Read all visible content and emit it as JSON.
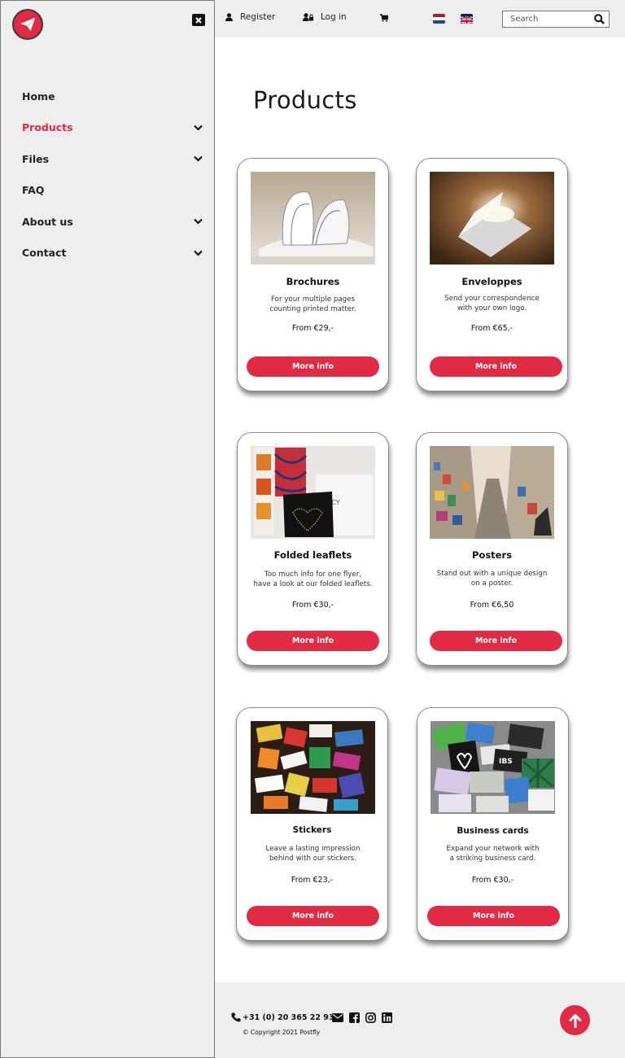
{
  "sidebar": {
    "logo_icon": "paper-plane-icon",
    "close_icon": "close-icon",
    "items": [
      {
        "label": "Home",
        "has_dropdown": false,
        "active": false
      },
      {
        "label": "Products",
        "has_dropdown": true,
        "active": true
      },
      {
        "label": "Files",
        "has_dropdown": true,
        "active": false
      },
      {
        "label": "FAQ",
        "has_dropdown": false,
        "active": false
      },
      {
        "label": "About us",
        "has_dropdown": true,
        "active": false
      },
      {
        "label": "Contact",
        "has_dropdown": true,
        "active": false
      }
    ]
  },
  "topbar": {
    "register_label": "Register",
    "login_label": "Log in",
    "cart_icon": "cart-icon",
    "languages": [
      "nl-flag-icon",
      "uk-flag-icon"
    ],
    "search_placeholder": "Search"
  },
  "main": {
    "title": "Products",
    "button_label": "More info",
    "products": [
      {
        "name": "Brochures",
        "desc": [
          "For your multiple pages",
          "counting printed matter."
        ],
        "price": "From €29,-"
      },
      {
        "name": "Enveloppes",
        "desc": [
          "Send your correspondence",
          "with your own logo."
        ],
        "price": "From €65,-"
      },
      {
        "name": "Folded leaflets",
        "desc": [
          "Too much info for one flyer,",
          "have a look at our folded leaflets."
        ],
        "price": "From €30,-"
      },
      {
        "name": "Posters",
        "desc": [
          "Stand out with a unique design",
          "on a poster."
        ],
        "price": "From €6,50"
      },
      {
        "name": "Stickers",
        "desc": [
          "Leave a lasting impression",
          "behind with our stickers."
        ],
        "price": "From €23,-"
      },
      {
        "name": "Business cards",
        "desc": [
          "Expand your network with",
          "a striking business card."
        ],
        "price": "From €30,-"
      }
    ]
  },
  "footer": {
    "phone": "+31 (0) 20 365 22 93",
    "copyright": "© Copyright 2021 Postfly",
    "social_icons": [
      "envelope-icon",
      "facebook-icon",
      "instagram-icon",
      "linkedin-icon"
    ]
  },
  "colors": {
    "accent": "#e12b45",
    "panel": "#eeeeee"
  }
}
